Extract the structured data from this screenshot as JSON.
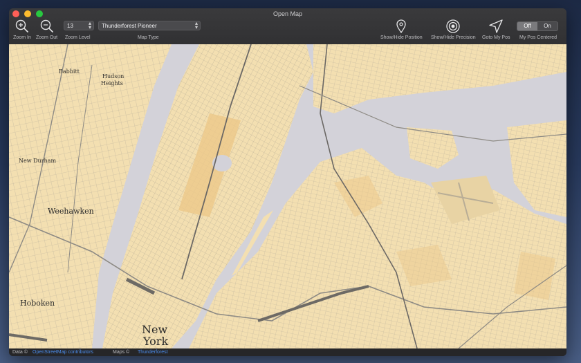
{
  "window": {
    "title": "Open Map"
  },
  "toolbar": {
    "zoom_in": {
      "label": "Zoom In",
      "icon": "zoom-in-icon"
    },
    "zoom_out": {
      "label": "Zoom Out",
      "icon": "zoom-out-icon"
    },
    "zoom_level": {
      "label": "Zoom Level",
      "value": "13"
    },
    "map_type": {
      "label": "Map Type",
      "value": "Thunderforest Pioneer"
    },
    "show_hide_position": {
      "label": "Show/Hide Position",
      "icon": "map-pin-icon"
    },
    "show_hide_precision": {
      "label": "Show/Hide Precision",
      "icon": "precision-target-icon"
    },
    "goto_my_pos": {
      "label": "Goto My Pos",
      "icon": "location-arrow-icon"
    },
    "my_pos_centered": {
      "label": "My Pos Centered",
      "off": "Off",
      "on": "On",
      "selected": "Off"
    }
  },
  "map": {
    "places": {
      "babbitt": "Babbitt",
      "hudson": "Hudson",
      "heights": "Heights",
      "new_durham": "New Durham",
      "weehawken": "Weehawken",
      "hoboken": "Hoboken",
      "new": "New",
      "york": "York"
    },
    "colors": {
      "land": "#f3dfb1",
      "water": "#d3d2d9",
      "park": "#ecc88a",
      "road": "#9a968e"
    }
  },
  "status": {
    "data_prefix": "Data ©",
    "data_link": "OpenStreetMap contributors",
    "maps_prefix": "Maps ©",
    "maps_link": "Thunderforest"
  }
}
